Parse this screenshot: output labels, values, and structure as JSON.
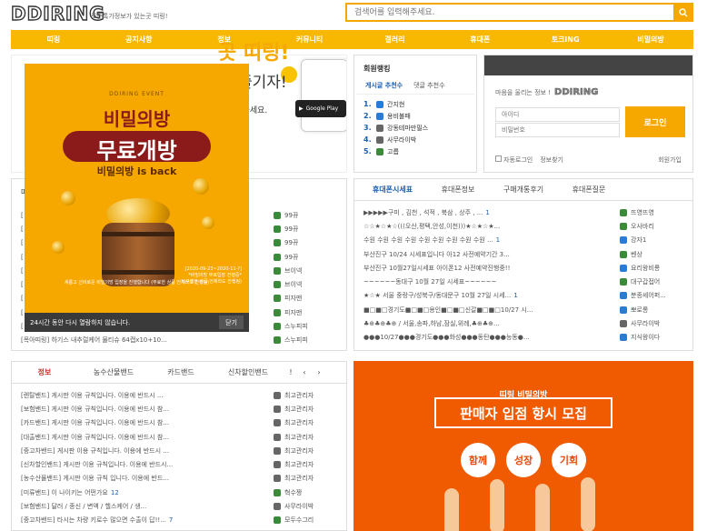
{
  "header": {
    "logo": "DDIRING",
    "tagline": "모든톡가정보가 있는곳 띠링!",
    "search_placeholder": "검색어를 입력해주세요."
  },
  "nav": [
    "띠링",
    "공지사항",
    "정보",
    "커뮤니티",
    "갤러리",
    "휴대폰",
    "토크iNG",
    "비밀의방"
  ],
  "banner": {
    "title": "곳 띠링!",
    "sub": "즐기자!",
    "small": "로드하세요.",
    "store": "Google Play"
  },
  "ranking": {
    "title": "회원랭킹",
    "tabs": [
      "게시글 추천수",
      "댓글 추천수"
    ],
    "items": [
      {
        "rank": "1.",
        "name": "간지현",
        "color": "#2a7bd6"
      },
      {
        "rank": "2.",
        "name": "용비불패",
        "color": "#2a7bd6"
      },
      {
        "rank": "3.",
        "name": "강동테마만필스",
        "color": "#666"
      },
      {
        "rank": "4.",
        "name": "사무라이박",
        "color": "#666"
      },
      {
        "rank": "5.",
        "name": "고릅",
        "color": "#3a8a3a"
      }
    ]
  },
  "login": {
    "msg": "마음을 울리는 정보 !",
    "brand": "DDIRING",
    "id_placeholder": "아이디",
    "pw_placeholder": "비밀번호",
    "button": "로그인",
    "auto": "자동로그인",
    "find": "정보찾기",
    "join": "회원가입"
  },
  "popup": {
    "event": "DDIRING EVENT",
    "line1": "비밀의방",
    "line2": "무료개방",
    "line3": "비밀의방 is back",
    "date": "[2020-09-23~2020-11-?]\n*비밀의방 무료입장 진행중*\n*(구매한 상품 언제라도 진행됨)",
    "note": "새롭고 신비로운 비밀의방 입장을 진행합니다 (무료한 상품 언제라도 진행됨)",
    "dismiss": "24시간 동안 다시 열람하지 않습니다.",
    "close": "닫기"
  },
  "left_list": {
    "prefix": "[",
    "users": [
      {
        "name": "99뀨",
        "color": "#3a8a3a"
      },
      {
        "name": "99뀨",
        "color": "#3a8a3a"
      },
      {
        "name": "99뀨",
        "color": "#3a8a3a"
      },
      {
        "name": "99뀨",
        "color": "#3a8a3a"
      },
      {
        "name": "브이넥",
        "color": "#3a8a3a"
      },
      {
        "name": "브이넥",
        "color": "#3a8a3a"
      },
      {
        "name": "피자맨",
        "color": "#3a8a3a"
      },
      {
        "name": "피자맨",
        "color": "#3a8a3a"
      },
      {
        "name": "스누피피",
        "color": "#3a8a3a"
      }
    ],
    "last_title": "[목아띠링] 하기스 내추럴케어 물티슈 64캡x10+10...",
    "last_user": "스누피피"
  },
  "phone_price": {
    "tabs": [
      "휴대폰시세표",
      "휴대폰정보",
      "구매개통후기",
      "휴대폰질문"
    ],
    "rows": [
      {
        "title": "▶▶▶▶▶구미 , 김천 , 석적 , 북삼 , 상주 , ...",
        "count": "1",
        "user": "뜨영뜨영",
        "color": "#3a8a3a"
      },
      {
        "title": "☆☆★☆★☆(((오산,평택,안성,이천)))★☆★☆★...",
        "count": "",
        "user": "오사바리",
        "color": "#3a8a3a"
      },
      {
        "title": "수원 수원 수원 수원 수원 수원 수원 수원 수원 ...",
        "count": "1",
        "user": "강자1",
        "color": "#2a7bd6"
      },
      {
        "title": "부산진구 10/24 시세표입니다 아12 사전예약기간 3...",
        "count": "",
        "user": "벤상",
        "color": "#3a8a3a"
      },
      {
        "title": "부산진구 10월27일시세표 아이폰12 사전예약진행중!!",
        "count": "",
        "user": "요리왕비룡",
        "color": "#2a7bd6"
      },
      {
        "title": "~~~~~~동대구 10월 27일 시세표~~~~~~",
        "count": "",
        "user": "대구갑접어",
        "color": "#3a8a3a"
      },
      {
        "title": "★☆★ 서울 중랑구/성북구/동대문구 10월 27일 시세...",
        "count": "1",
        "user": "분종세어퍼...",
        "color": "#2a7bd6"
      },
      {
        "title": "■□■□경기도■□■□용인■□■□신갈■□■□10/27 시...",
        "count": "",
        "user": "뽀로롱",
        "color": "#2a7bd6"
      },
      {
        "title": "♣⊕♣⊕♣⊕ / 서울,송파,하남,잠실,위례,♣⊕♣⊕...",
        "count": "",
        "user": "사무라이박",
        "color": "#666"
      },
      {
        "title": "●●●10/27●●●경기도●●●화성●●●동탄●●●능동●...",
        "count": "",
        "user": "지식왕이다",
        "color": "#2a7bd6"
      }
    ]
  },
  "info_board": {
    "tabs": [
      "정보",
      "농수산물밴드",
      "카드밴드",
      "신차할인밴드",
      "!"
    ],
    "rows": [
      {
        "title": "[렌탈밴드] 게시판 이용 규칙입니다. 이용에 반드시 ...",
        "count": "",
        "user": "최고관리자",
        "color": "#666"
      },
      {
        "title": "[보험밴드] 게시판 이용 규칙입니다. 이용에 반드시 참...",
        "count": "",
        "user": "최고관리자",
        "color": "#666"
      },
      {
        "title": "[카드밴드] 게시판 이용 규칙입니다. 이용에 반드시 참...",
        "count": "",
        "user": "최고관리자",
        "color": "#666"
      },
      {
        "title": "[대출밴드] 게시판 이용 규칙입니다. 이용에 반드시 참...",
        "count": "",
        "user": "최고관리자",
        "color": "#666"
      },
      {
        "title": "[중고차밴드] 게시판 이용 규칙입니다. 이용에 반드시 ...",
        "count": "",
        "user": "최고관리자",
        "color": "#666"
      },
      {
        "title": "[신차할인밴드] 게시판 이용 규칙입니다. 이용에 반드시...",
        "count": "",
        "user": "최고관리자",
        "color": "#666"
      },
      {
        "title": "[농수산물밴드] 게시판 이용 규칙 입니다. 이용에 반드...",
        "count": "",
        "user": "최고관리자",
        "color": "#666"
      },
      {
        "title": "[미류밴드] 이 나이키는 어떤가요",
        "count": "12",
        "user": "혁수짱",
        "color": "#3a8a3a"
      },
      {
        "title": "[보험밴드] 달러 / 종신 / 변액 / 헬스케어 / 생...",
        "count": "",
        "user": "사무라이박",
        "color": "#666"
      },
      {
        "title": "[중고차밴드] 타시는 차량 키로수 많으면 수출이 답!!...",
        "count": "7",
        "user": "모두수그리",
        "color": "#3a8a3a"
      }
    ]
  },
  "promo": {
    "sub": "띠링 비밀의방",
    "main": "판매자 입점 항시 모집",
    "bubbles": [
      "함께",
      "성장",
      "기회"
    ]
  }
}
